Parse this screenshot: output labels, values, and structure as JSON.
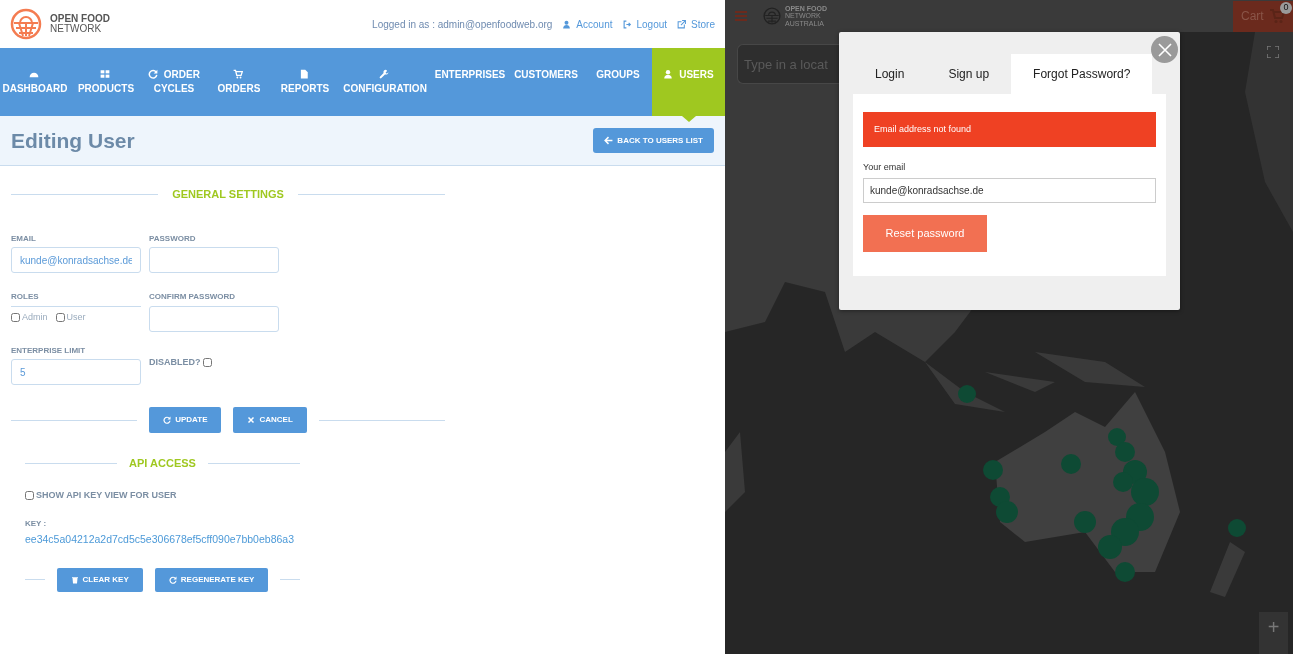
{
  "admin": {
    "logo": {
      "line1": "OPEN FOOD",
      "line2": "NETWORK"
    },
    "logged_in": "Logged in as : admin@openfoodweb.org",
    "links": [
      {
        "label": "Account",
        "kind": "user"
      },
      {
        "label": "Logout",
        "kind": "logout"
      },
      {
        "label": "Store",
        "kind": "external"
      }
    ],
    "nav": [
      {
        "label": "DASHBOARD",
        "kind": "dashboard",
        "selected": false
      },
      {
        "label": "PRODUCTS",
        "kind": "grid",
        "selected": false
      },
      {
        "label": "ORDER CYCLES",
        "kind": "refresh",
        "selected": false
      },
      {
        "label": "ORDERS",
        "kind": "cart",
        "selected": false
      },
      {
        "label": "REPORTS",
        "kind": "file",
        "selected": false
      },
      {
        "label": "CONFIGURATION",
        "kind": "wrench",
        "selected": false
      },
      {
        "label": "ENTERPRISES",
        "selected": false
      },
      {
        "label": "CUSTOMERS",
        "selected": false
      },
      {
        "label": "GROUPS",
        "selected": false
      },
      {
        "label": "USERS",
        "kind": "user",
        "selected": true
      }
    ],
    "page_title": "Editing User",
    "back_button": "BACK TO USERS LIST",
    "general_settings": {
      "heading": "GENERAL SETTINGS",
      "email": {
        "label": "EMAIL",
        "value": "kunde@konradsachse.de"
      },
      "password": {
        "label": "PASSWORD"
      },
      "roles": {
        "label": "ROLES",
        "options": [
          {
            "label": "Admin",
            "checked": false
          },
          {
            "label": "User",
            "checked": false
          }
        ]
      },
      "confirm_password": {
        "label": "CONFIRM PASSWORD"
      },
      "enterprise_limit": {
        "label": "ENTERPRISE LIMIT",
        "value": "5"
      },
      "disabled": {
        "label": "DISABLED?",
        "checked": false
      }
    },
    "actions": [
      {
        "label": "UPDATE",
        "kind": "refresh"
      },
      {
        "label": "CANCEL",
        "kind": "times"
      }
    ],
    "api_access": {
      "heading": "API ACCESS",
      "show_key": {
        "label": "SHOW API KEY VIEW FOR USER",
        "checked": false
      },
      "key_label": "KEY :",
      "key": "ee34c5a04212a2d7cd5c5e306678ef5cff090e7bb0eb86a3",
      "actions": [
        {
          "label": "CLEAR KEY",
          "kind": "trash"
        },
        {
          "label": "REGENERATE KEY",
          "kind": "refresh"
        }
      ]
    }
  },
  "shop": {
    "logo": {
      "line1": "OPEN FOOD",
      "line2": "NETWORK",
      "line3": "AUSTRALIA"
    },
    "cart": {
      "label": "Cart",
      "count": "0"
    },
    "search": {
      "placeholder": "Type in a locat"
    },
    "zoom": "+",
    "modal": {
      "tabs": [
        {
          "label": "Login",
          "selected": false
        },
        {
          "label": "Sign up",
          "selected": false
        },
        {
          "label": "Forgot Password?",
          "selected": true
        }
      ],
      "alert": "Email address not found",
      "email": {
        "label": "Your email",
        "value": "kunde@konradsachse.de"
      },
      "submit": "Reset password"
    }
  }
}
